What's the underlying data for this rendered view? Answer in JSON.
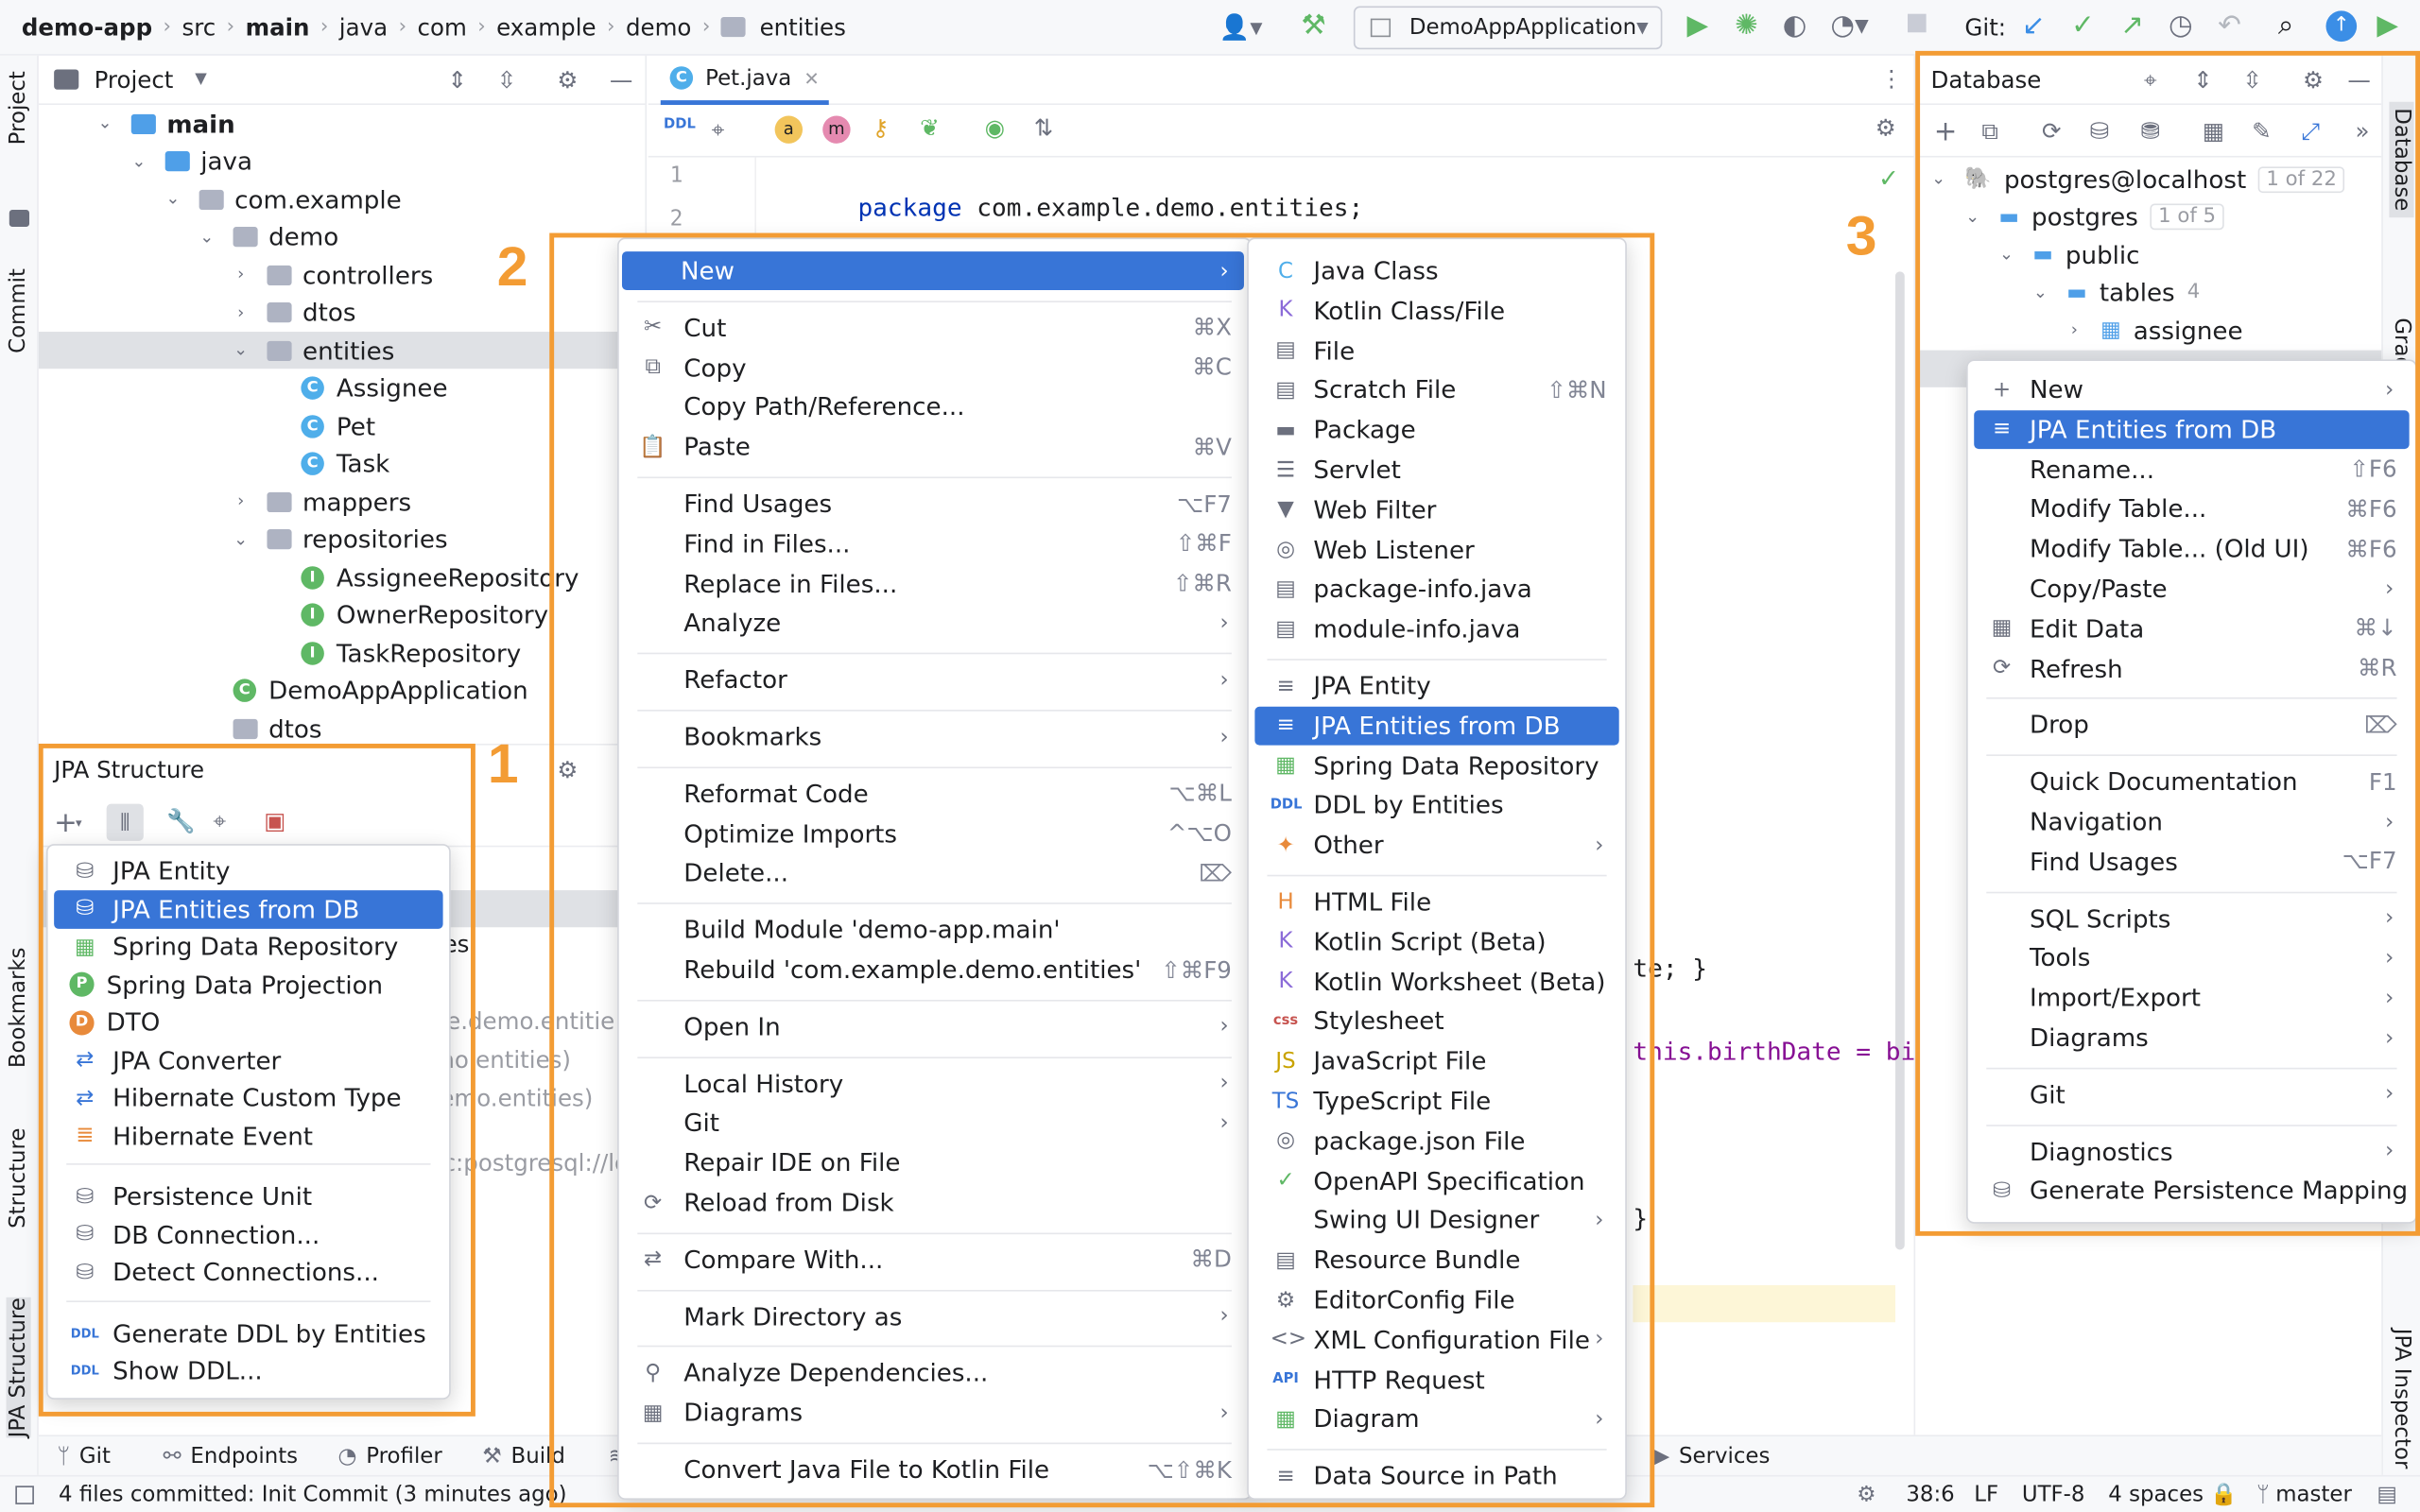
{
  "toolbar": {
    "project": "demo-app",
    "path": [
      "src",
      "main",
      "java",
      "com",
      "example",
      "demo",
      "entities"
    ],
    "run_config": "DemoAppApplication",
    "git_label": "Git:"
  },
  "left_stripe": {
    "project": "Project",
    "commit": "Commit",
    "bookmarks": "Bookmarks",
    "structure": "Structure",
    "jpa_structure": "JPA Structure"
  },
  "right_stripe": {
    "database": "Database",
    "gradle": "Gradle",
    "jpa_inspector": "JPA Inspector"
  },
  "project_panel": {
    "title": "Project",
    "tree": [
      {
        "label": "main",
        "kind": "folder-blue"
      },
      {
        "label": "java",
        "kind": "folder-blue"
      },
      {
        "label": "com.example",
        "kind": "package"
      },
      {
        "label": "demo",
        "kind": "package"
      },
      {
        "label": "controllers",
        "kind": "package"
      },
      {
        "label": "dtos",
        "kind": "package"
      },
      {
        "label": "entities",
        "kind": "package"
      },
      {
        "label": "Assignee",
        "kind": "class"
      },
      {
        "label": "Pet",
        "kind": "class"
      },
      {
        "label": "Task",
        "kind": "class"
      },
      {
        "label": "mappers",
        "kind": "package"
      },
      {
        "label": "repositories",
        "kind": "package"
      },
      {
        "label": "AssigneeRepository",
        "kind": "interface"
      },
      {
        "label": "OwnerRepository",
        "kind": "interface"
      },
      {
        "label": "TaskRepository",
        "kind": "interface"
      },
      {
        "label": "DemoAppApplication",
        "kind": "spring"
      },
      {
        "label": "dtos",
        "kind": "package"
      }
    ]
  },
  "jpa_structure": {
    "title": "JPA Structure",
    "behind_texts": [
      "es",
      "le.demo.entitie",
      "no.entities)",
      "emo.entities)",
      "c:postgresql://lo"
    ],
    "menu": [
      {
        "label": "JPA Entity",
        "icon": "db-icon"
      },
      {
        "label": "JPA Entities from DB",
        "icon": "db-icon"
      },
      {
        "label": "Spring Data Repository",
        "icon": "repo-icon"
      },
      {
        "label": "Spring Data Projection",
        "icon": "P"
      },
      {
        "label": "DTO",
        "icon": "D"
      },
      {
        "label": "JPA Converter",
        "icon": "convert-icon"
      },
      {
        "label": "Hibernate Custom Type",
        "icon": "convert-icon"
      },
      {
        "label": "Hibernate Event",
        "icon": "event-icon"
      },
      {
        "label": "Persistence Unit",
        "icon": ""
      },
      {
        "label": "DB Connection...",
        "icon": "db-icon"
      },
      {
        "label": "Detect Connections...",
        "icon": ""
      },
      {
        "label": "Generate DDL by Entities",
        "icon": "ddl-icon"
      },
      {
        "label": "Show DDL...",
        "icon": "ddl-icon"
      }
    ]
  },
  "editor": {
    "tab": "Pet.java",
    "line_numbers": [
      "1",
      "2"
    ],
    "line1_kw": "package",
    "line1_rest": " com.example.demo.entities;",
    "frag1": "te; }",
    "frag2": "this.birthDate = bi",
    "frag3": "}"
  },
  "context_menu": {
    "items": [
      {
        "label": "New",
        "shortcut": "",
        "submenu": true,
        "icon": ""
      },
      {
        "label": "Cut",
        "shortcut": "⌘X",
        "icon": "✂"
      },
      {
        "label": "Copy",
        "shortcut": "⌘C",
        "icon": "⧉"
      },
      {
        "label": "Copy Path/Reference...",
        "shortcut": ""
      },
      {
        "label": "Paste",
        "shortcut": "⌘V",
        "icon": "📋"
      },
      {
        "label": "Find Usages",
        "shortcut": "⌥F7"
      },
      {
        "label": "Find in Files...",
        "shortcut": "⇧⌘F"
      },
      {
        "label": "Replace in Files...",
        "shortcut": "⇧⌘R"
      },
      {
        "label": "Analyze",
        "submenu": true
      },
      {
        "label": "Refactor",
        "submenu": true
      },
      {
        "label": "Bookmarks",
        "submenu": true
      },
      {
        "label": "Reformat Code",
        "shortcut": "⌥⌘L"
      },
      {
        "label": "Optimize Imports",
        "shortcut": "^⌥O"
      },
      {
        "label": "Delete...",
        "shortcut": "⌦"
      },
      {
        "label": "Build Module 'demo-app.main'",
        "shortcut": ""
      },
      {
        "label": "Rebuild 'com.example.demo.entities'",
        "shortcut": "⇧⌘F9"
      },
      {
        "label": "Open In",
        "submenu": true
      },
      {
        "label": "Local History",
        "submenu": true
      },
      {
        "label": "Git",
        "submenu": true
      },
      {
        "label": "Repair IDE on File",
        "shortcut": ""
      },
      {
        "label": "Reload from Disk",
        "shortcut": "",
        "icon": "⟳"
      },
      {
        "label": "Compare With...",
        "shortcut": "⌘D",
        "icon": "⇄"
      },
      {
        "label": "Mark Directory as",
        "submenu": true
      },
      {
        "label": "Analyze Dependencies...",
        "icon": "⚲"
      },
      {
        "label": "Diagrams",
        "submenu": true,
        "icon": "▦"
      },
      {
        "label": "Convert Java File to Kotlin File",
        "shortcut": "⌥⇧⌘K"
      }
    ]
  },
  "new_submenu": {
    "items": [
      {
        "label": "Java Class",
        "icon": "C"
      },
      {
        "label": "Kotlin Class/File",
        "icon": "K"
      },
      {
        "label": "File",
        "icon": "▤"
      },
      {
        "label": "Scratch File",
        "icon": "▤",
        "shortcut": "⇧⌘N"
      },
      {
        "label": "Package",
        "icon": "▬"
      },
      {
        "label": "Servlet",
        "icon": "☰"
      },
      {
        "label": "Web Filter",
        "icon": "▼"
      },
      {
        "label": "Web Listener",
        "icon": "◎"
      },
      {
        "label": "package-info.java",
        "icon": "▤"
      },
      {
        "label": "module-info.java",
        "icon": "▤"
      },
      {
        "label": "JPA Entity",
        "icon": "≡"
      },
      {
        "label": "JPA Entities from DB",
        "icon": "≡"
      },
      {
        "label": "Spring Data Repository",
        "icon": "▦"
      },
      {
        "label": "DDL by Entities",
        "icon": "DDL"
      },
      {
        "label": "Other",
        "icon": "✦",
        "submenu": true
      },
      {
        "label": "HTML File",
        "icon": "H"
      },
      {
        "label": "Kotlin Script (Beta)",
        "icon": "K"
      },
      {
        "label": "Kotlin Worksheet (Beta)",
        "icon": "K"
      },
      {
        "label": "Stylesheet",
        "icon": "css"
      },
      {
        "label": "JavaScript File",
        "icon": "JS"
      },
      {
        "label": "TypeScript File",
        "icon": "TS"
      },
      {
        "label": "package.json File",
        "icon": "◎"
      },
      {
        "label": "OpenAPI Specification",
        "icon": "✓"
      },
      {
        "label": "Swing UI Designer",
        "icon": "",
        "submenu": true
      },
      {
        "label": "Resource Bundle",
        "icon": "▤"
      },
      {
        "label": "EditorConfig File",
        "icon": "⚙"
      },
      {
        "label": "XML Configuration File",
        "icon": "<>",
        "submenu": true
      },
      {
        "label": "HTTP Request",
        "icon": "API"
      },
      {
        "label": "Diagram",
        "icon": "▦",
        "submenu": true
      },
      {
        "label": "Data Source in Path",
        "icon": "≡"
      }
    ]
  },
  "database_panel": {
    "title": "Database",
    "tree": [
      {
        "label": "postgres@localhost",
        "badge": "1 of 22"
      },
      {
        "label": "postgres",
        "badge": "1 of 5"
      },
      {
        "label": "public",
        "badge": ""
      },
      {
        "label": "tables",
        "badge": "4"
      },
      {
        "label": "assignee",
        "badge": ""
      }
    ]
  },
  "db_menu": {
    "items": [
      {
        "label": "New",
        "icon": "+",
        "submenu": true
      },
      {
        "label": "JPA Entities from DB",
        "icon": "≡"
      },
      {
        "label": "Rename...",
        "shortcut": "⇧F6"
      },
      {
        "label": "Modify Table...",
        "shortcut": "⌘F6"
      },
      {
        "label": "Modify Table... (Old UI)",
        "shortcut": "⌘F6"
      },
      {
        "label": "Copy/Paste",
        "submenu": true
      },
      {
        "label": "Edit Data",
        "icon": "▦",
        "shortcut": "⌘↓"
      },
      {
        "label": "Refresh",
        "icon": "⟳",
        "shortcut": "⌘R"
      },
      {
        "label": "Drop",
        "shortcut": "⌦"
      },
      {
        "label": "Quick Documentation",
        "shortcut": "F1"
      },
      {
        "label": "Navigation",
        "submenu": true
      },
      {
        "label": "Find Usages",
        "shortcut": "⌥F7"
      },
      {
        "label": "SQL Scripts",
        "submenu": true
      },
      {
        "label": "Tools",
        "submenu": true
      },
      {
        "label": "Import/Export",
        "submenu": true
      },
      {
        "label": "Diagrams",
        "submenu": true
      },
      {
        "label": "Git",
        "submenu": true
      },
      {
        "label": "Diagnostics",
        "submenu": true
      },
      {
        "label": "Generate Persistence Mapping",
        "icon": "⛁"
      }
    ]
  },
  "callouts": {
    "one": "1",
    "two": "2",
    "three": "3"
  },
  "bottom_tools": [
    "Git",
    "Endpoints",
    "Profiler",
    "Build",
    "Services"
  ],
  "status_bar": {
    "message": "4 files committed: Init Commit (3 minutes ago)",
    "position": "38:6",
    "line_sep": "LF",
    "encoding": "UTF-8",
    "indent": "4 spaces",
    "branch": "master"
  },
  "colors": {
    "selection": "#3875d7",
    "callout": "#f39c34"
  }
}
